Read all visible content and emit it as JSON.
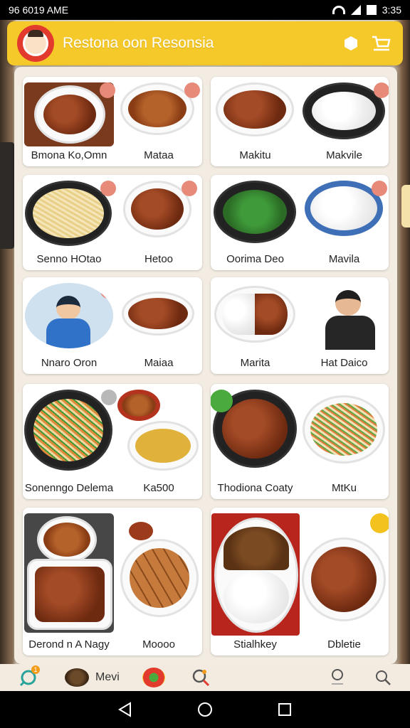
{
  "status_bar": {
    "time": "96 6019 AME",
    "right_time": "3:35"
  },
  "header": {
    "title": "Restona oon Resonsia",
    "brand_color": "#f6c92a"
  },
  "icons": {
    "avatar": "chef-avatar",
    "settings": "hexagon-settings-icon",
    "cart": "cart-icon"
  },
  "menu": {
    "row1": [
      {
        "label": "Bmona Ko,Omn",
        "badge": "ic"
      },
      {
        "label": "Mataa",
        "badge": "ic"
      },
      {
        "label": "Makitu",
        "badge": ""
      },
      {
        "label": "Makvile",
        "badge": "ic"
      }
    ],
    "row2": [
      {
        "label": "Senno HOtao",
        "badge": "ic"
      },
      {
        "label": "Hetoo",
        "badge": "ic"
      },
      {
        "label": "Oorima Deo",
        "badge": ""
      },
      {
        "label": "Mavila",
        "badge": "ic"
      }
    ],
    "row3": [
      {
        "label": "Nnaro Oron",
        "badge": "ic"
      },
      {
        "label": "Maiaa",
        "badge": ""
      },
      {
        "label": "Marita",
        "badge": ""
      },
      {
        "label": "Hat Daico",
        "badge": ""
      }
    ],
    "row4": [
      {
        "label": "Sonenngo Delema",
        "badge": "ic"
      },
      {
        "label": "Ka500",
        "badge": ""
      },
      {
        "label": "Thodiona Coaty",
        "badge": ""
      },
      {
        "label": "MtKu",
        "badge": ""
      }
    ],
    "row5": [
      {
        "label": "Derond n A Nagy",
        "badge": ""
      },
      {
        "label": "Moooo",
        "badge": ""
      },
      {
        "label": "Stialhkey",
        "badge": ""
      },
      {
        "label": "Dbletie",
        "badge": "ic"
      }
    ]
  },
  "bottom_nav": {
    "items": [
      {
        "icon": "discover-icon",
        "label": ""
      },
      {
        "icon": "food-avatar-icon",
        "label": "Mevi"
      },
      {
        "icon": "dish-icon",
        "label": ""
      },
      {
        "icon": "search-deal-icon",
        "label": ""
      },
      {
        "icon": "profile-icon",
        "label": ""
      },
      {
        "icon": "search-icon",
        "label": ""
      }
    ],
    "badge_count": "1"
  }
}
